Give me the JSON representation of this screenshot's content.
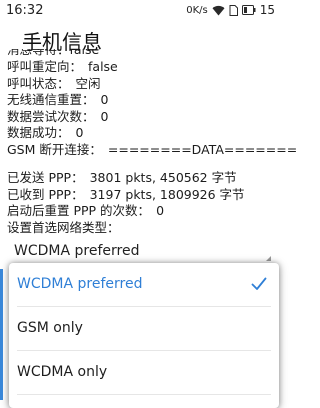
{
  "status_bar": {
    "time": "16:32",
    "network_speed": "0K/s",
    "battery_level": "15",
    "icons": [
      "wifi-icon",
      "sim-icon",
      "battery-icon"
    ]
  },
  "page": {
    "title": "手机信息"
  },
  "info_rows": {
    "clipped": "消息等待：false",
    "call_redirect": {
      "label": "呼叫重定向：",
      "value": "false"
    },
    "call_status": {
      "label": "呼叫状态：",
      "value": "空闲"
    },
    "radio_resets": {
      "label": "无线通信重置：",
      "value": "0"
    },
    "data_attempts": {
      "label": "数据尝试次数：",
      "value": "0"
    },
    "data_success": {
      "label": "数据成功：",
      "value": "0"
    },
    "gsm_disconnect": {
      "label": "GSM 断开连接：",
      "value": "========DATA======="
    },
    "ppp_sent": {
      "label": "已发送 PPP：",
      "value": "3801 pkts, 450562 字节"
    },
    "ppp_received": {
      "label": "已收到 PPP：",
      "value": "3197 pkts, 1809926 字节"
    },
    "ppp_resets": {
      "label": "启动后重置 PPP 的次数：",
      "value": "0"
    },
    "preferred_network_label": "设置首选网络类型："
  },
  "spinner": {
    "selected_value": "WCDMA preferred"
  },
  "dropdown": {
    "options": [
      {
        "label": "WCDMA preferred",
        "selected": true
      },
      {
        "label": "GSM only",
        "selected": false
      },
      {
        "label": "WCDMA only",
        "selected": false
      }
    ]
  },
  "colors": {
    "accent": "#2f7fd6",
    "text": "#1c1c1c",
    "background": "#ffffff"
  }
}
